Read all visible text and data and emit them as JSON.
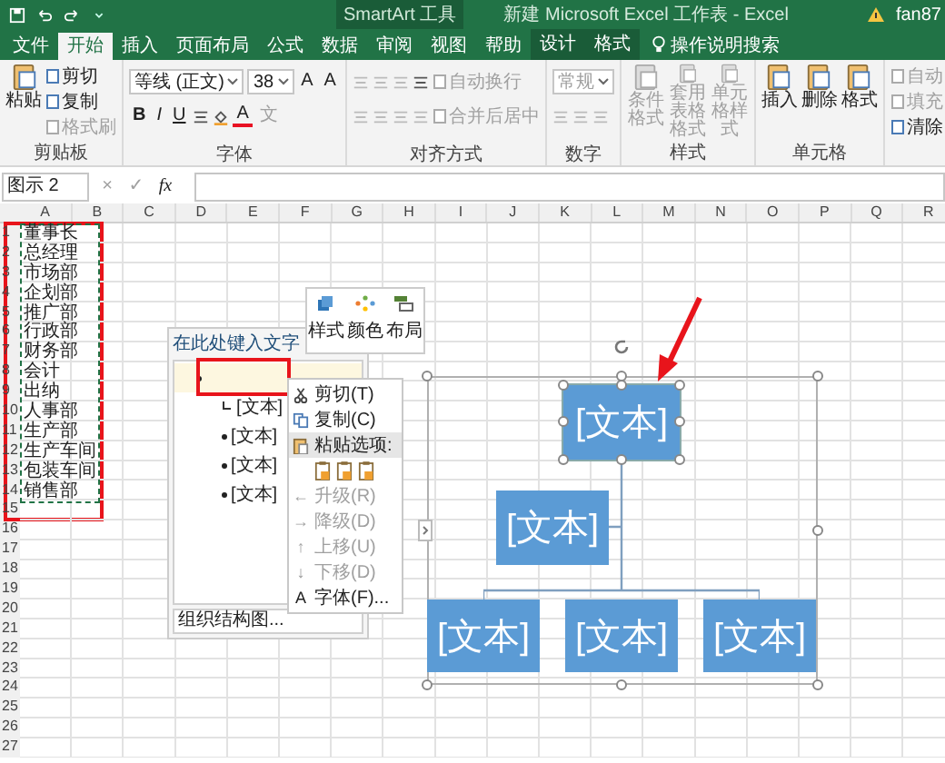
{
  "title_bar": {
    "contextual_label": "SmartArt 工具",
    "title": "新建 Microsoft Excel 工作表 - Excel",
    "user": "fan87"
  },
  "tabs": [
    {
      "label": "文件",
      "selected": false,
      "contextual": false
    },
    {
      "label": "开始",
      "selected": true,
      "contextual": false
    },
    {
      "label": "插入",
      "selected": false,
      "contextual": false
    },
    {
      "label": "页面布局",
      "selected": false,
      "contextual": false
    },
    {
      "label": "公式",
      "selected": false,
      "contextual": false
    },
    {
      "label": "数据",
      "selected": false,
      "contextual": false
    },
    {
      "label": "审阅",
      "selected": false,
      "contextual": false
    },
    {
      "label": "视图",
      "selected": false,
      "contextual": false
    },
    {
      "label": "帮助",
      "selected": false,
      "contextual": false
    },
    {
      "label": "设计",
      "selected": false,
      "contextual": true
    },
    {
      "label": "格式",
      "selected": false,
      "contextual": true
    }
  ],
  "tell_me": "操作说明搜索",
  "ribbon": [
    {
      "label": "剪贴板",
      "items": [
        {
          "kind": "large",
          "label": "粘贴",
          "disabled": false
        },
        {
          "kind": "small",
          "label": "剪切",
          "disabled": false
        },
        {
          "kind": "small",
          "label": "复制",
          "disabled": false
        },
        {
          "kind": "small",
          "label": "格式刷",
          "disabled": true
        }
      ]
    },
    {
      "label": "字体",
      "top_row": [
        {
          "kind": "field",
          "label": "等线 (正文)",
          "disabled": false
        },
        {
          "kind": "field",
          "label": "38",
          "disabled": false
        },
        {
          "kind": "glyph",
          "label": "A",
          "disabled": false
        },
        {
          "kind": "glyph",
          "label": "A",
          "disabled": false
        }
      ],
      "bottom_row": [
        {
          "kind": "glyph",
          "label": "B",
          "disabled": false
        },
        {
          "kind": "glyph",
          "label": "I",
          "disabled": false
        },
        {
          "kind": "glyph",
          "label": "U",
          "disabled": false
        },
        {
          "kind": "icon",
          "disabled": false
        },
        {
          "kind": "fill",
          "disabled": false
        },
        {
          "kind": "fontcolor",
          "label": "A",
          "disabled": false
        },
        {
          "kind": "glyph",
          "label": "文",
          "disabled": true
        }
      ]
    },
    {
      "label": "对齐方式",
      "top_row": [
        {
          "kind": "icon",
          "disabled": true
        },
        {
          "kind": "icon",
          "disabled": true
        },
        {
          "kind": "icon",
          "disabled": true
        },
        {
          "kind": "icon",
          "disabled": false
        },
        {
          "kind": "small",
          "label": "自动换行",
          "disabled": true
        }
      ],
      "bottom_row": [
        {
          "kind": "icon",
          "disabled": true
        },
        {
          "kind": "icon",
          "disabled": true
        },
        {
          "kind": "icon",
          "disabled": true
        },
        {
          "kind": "icon",
          "disabled": true
        },
        {
          "kind": "small",
          "label": "合并后居中",
          "disabled": true
        }
      ]
    },
    {
      "label": "数字",
      "top_row": [
        {
          "kind": "field",
          "label": "常规",
          "disabled": true
        }
      ],
      "bottom_row": [
        {
          "kind": "icon",
          "disabled": true
        },
        {
          "kind": "icon",
          "disabled": true
        },
        {
          "kind": "icon",
          "disabled": true
        }
      ]
    },
    {
      "label": "样式",
      "items": [
        {
          "kind": "large",
          "label": "条件格式",
          "disabled": true
        },
        {
          "kind": "large",
          "label": "套用表格格式",
          "disabled": true
        },
        {
          "kind": "large",
          "label": "单元格样式",
          "disabled": true
        }
      ]
    },
    {
      "label": "单元格",
      "items": [
        {
          "kind": "large",
          "label": "插入",
          "disabled": false
        },
        {
          "kind": "large",
          "label": "删除",
          "disabled": false
        },
        {
          "kind": "large",
          "label": "格式",
          "disabled": false
        }
      ]
    },
    {
      "items": [
        {
          "kind": "small",
          "label": "自动",
          "disabled": true
        },
        {
          "kind": "small",
          "label": "填充",
          "disabled": true
        },
        {
          "kind": "small",
          "label": "清除",
          "disabled": false
        }
      ]
    }
  ],
  "formula_bar": {
    "name_box": "图示 2",
    "buttons": [
      {
        "label": "×",
        "disabled": true
      },
      {
        "label": "✓",
        "disabled": true
      },
      {
        "label": "fx",
        "disabled": false
      }
    ]
  },
  "sheet": {
    "columns": [
      "A",
      "B",
      "C",
      "D",
      "E",
      "F",
      "G",
      "H",
      "I",
      "J",
      "K",
      "L",
      "M",
      "N",
      "O",
      "P",
      "Q",
      "R"
    ],
    "rows": [
      "1",
      "2",
      "3",
      "4",
      "5",
      "6",
      "7",
      "8",
      "9",
      "10",
      "11",
      "12",
      "13",
      "14",
      "15",
      "16",
      "17",
      "18",
      "19",
      "20",
      "21",
      "22",
      "23",
      "24",
      "25",
      "26",
      "27"
    ],
    "column_a": [
      "董事长",
      "总经理",
      "市场部",
      "企划部",
      "推广部",
      "行政部",
      "财务部",
      "会计",
      "出纳",
      "人事部",
      "生产部",
      "生产车间",
      "包装车间",
      "销售部"
    ]
  },
  "mini_toolbar": [
    {
      "kind": "styles",
      "label": "样式"
    },
    {
      "kind": "colors",
      "label": "颜色"
    },
    {
      "kind": "layout",
      "label": "布局"
    }
  ],
  "text_pane": {
    "title": "在此处键入文字",
    "items": [
      {
        "selected": true,
        "children": [
          {
            "kind": "assistant",
            "text": "[文本]",
            "selected": false
          },
          {
            "kind": "bullet",
            "text": "[文本]",
            "selected": false
          },
          {
            "kind": "bullet",
            "text": "[文本]",
            "selected": false
          },
          {
            "kind": "bullet",
            "text": "[文本]",
            "selected": false
          }
        ]
      }
    ],
    "footer": "组织结构图..."
  },
  "context_menu": [
    {
      "kind": "cut",
      "label": "剪切(T)",
      "disabled": false,
      "selected": false
    },
    {
      "kind": "copy",
      "label": "复制(C)",
      "disabled": false,
      "selected": false
    },
    {
      "kind": "paste",
      "label": "粘贴选项:",
      "disabled": false,
      "selected": true
    },
    {
      "kind": "pasteicons",
      "disabled": false,
      "selected": false
    },
    {
      "kind": "glyph",
      "glyph": "←",
      "label": "升级(R)",
      "disabled": true,
      "selected": false
    },
    {
      "kind": "glyph",
      "glyph": "→",
      "label": "降级(D)",
      "disabled": true,
      "selected": false
    },
    {
      "kind": "glyph",
      "glyph": "↑",
      "label": "上移(U)",
      "disabled": true,
      "selected": false
    },
    {
      "kind": "glyph",
      "glyph": "↓",
      "label": "下移(D)",
      "disabled": true,
      "selected": false
    },
    {
      "kind": "glyph",
      "glyph": "A",
      "label": "字体(F)...",
      "disabled": false,
      "selected": false
    }
  ],
  "smartart": {
    "top": {
      "text": "[文本]",
      "selected": true
    },
    "assistant": {
      "text": "[文本]",
      "selected": false
    },
    "children": [
      {
        "text": "[文本]",
        "selected": false
      },
      {
        "text": "[文本]",
        "selected": false
      },
      {
        "text": "[文本]",
        "selected": false
      }
    ]
  }
}
